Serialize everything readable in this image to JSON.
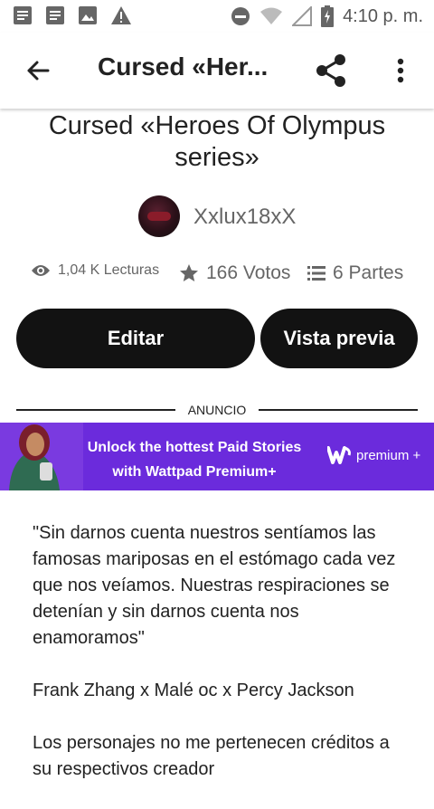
{
  "status_bar": {
    "time": "4:10 p. m.",
    "left_icons": [
      "notes-icon",
      "notes-icon",
      "image-icon",
      "warning-icon"
    ],
    "right_icons": [
      "do-not-disturb-icon",
      "wifi-icon",
      "signal-icon",
      "battery-charging-icon"
    ]
  },
  "app_bar": {
    "title": "Cursed «Her...",
    "back_icon": "arrow-back-icon",
    "share_icon": "share-icon",
    "more_icon": "more-vert-icon"
  },
  "story": {
    "title": "Cursed «Heroes Of Olympus series»",
    "author": "Xxlux18xX",
    "stats": {
      "reads": "1,04 K Lecturas",
      "votes": "166 Votos",
      "parts": "6 Partes"
    },
    "buttons": {
      "edit": "Editar",
      "preview": "Vista previa"
    }
  },
  "ad": {
    "label": "ANUNCIO",
    "banner_line1": "Unlock the hottest Paid Stories",
    "banner_line2": "with Wattpad Premium+",
    "premium_label": "premium +",
    "colors": {
      "banner_bg": "#6b2bdc"
    }
  },
  "description": {
    "quote": "\"Sin darnos cuenta nuestros sentíamos las famosas mariposas en el estómago cada vez que nos veíamos. Nuestras respiraciones se detenían y sin darnos cuenta nos enamoramos\"",
    "pairing": "Frank Zhang x Malé oc x Percy Jackson",
    "disclaimer": "Los personajes no me pertenecen créditos a su respectivos creador"
  },
  "colors": {
    "button_bg": "#121212",
    "text_primary": "#222222",
    "text_secondary": "#666666"
  }
}
